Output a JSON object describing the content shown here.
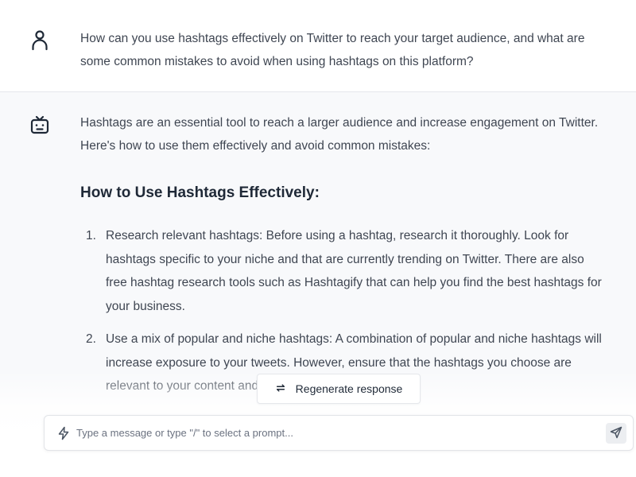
{
  "user_message": {
    "avatar_icon": "user-icon",
    "text": "How can you use hashtags effectively on Twitter to reach your target audience, and what are some common mistakes to avoid when using hashtags on this platform?"
  },
  "bot_message": {
    "avatar_icon": "robot-icon",
    "intro": "Hashtags are an essential tool to reach a larger audience and increase engagement on Twitter. Here's how to use them effectively and avoid common mistakes:",
    "heading": "How to Use Hashtags Effectively:",
    "list": [
      {
        "num": "1.",
        "text": "Research relevant hashtags: Before using a hashtag, research it thoroughly. Look for hashtags specific to your niche and that are currently trending on Twitter. There are also free hashtag research tools such as Hashtagify that can help you find the best hashtags for your business."
      },
      {
        "num": "2.",
        "text": "Use a mix of popular and niche hashtags: A combination of popular and niche hashtags will increase exposure to your tweets. However, ensure that the hashtags you choose are relevant to your content and not just for the sake of reach."
      }
    ]
  },
  "regenerate": {
    "label": "Regenerate response",
    "icon": "refresh-icon"
  },
  "composer": {
    "placeholder": "Type a message or type \"/\" to select a prompt...",
    "value": "",
    "prompt_icon": "bolt-icon",
    "send_icon": "send-icon"
  }
}
